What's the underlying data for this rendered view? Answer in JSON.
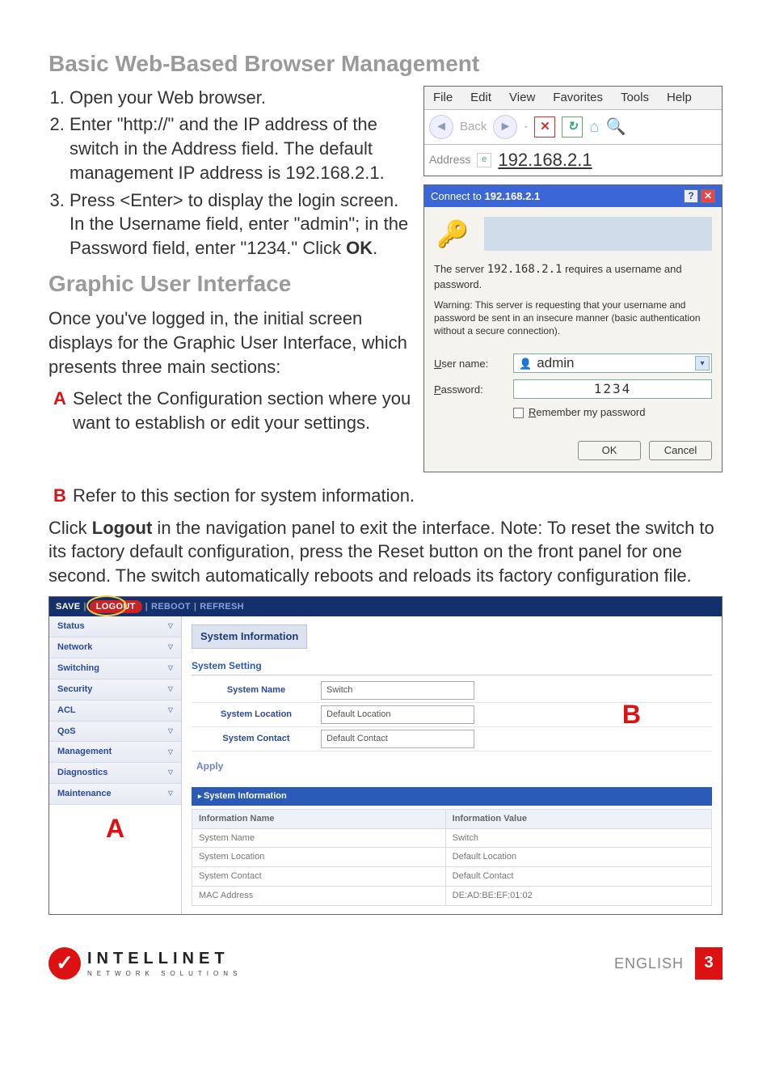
{
  "headings": {
    "h1": "Basic Web-Based Browser Management",
    "h2": "Graphic User Interface"
  },
  "steps": {
    "s1": "Open your Web browser.",
    "s2a": "Enter \"http://\" and the IP address of the switch in the Address field. The default management IP address is 192.168.2.1.",
    "s3a": "Press <Enter> to display the login screen. In the Username field, enter \"admin\"; in the Password field, enter \"1234.\" Click ",
    "s3b": "OK",
    "s3c": "."
  },
  "gui_intro": "Once you've logged in, the initial screen displays for the Graphic User Interface, which presents three main sections:",
  "letters": {
    "a_label": "A",
    "a_text": "Select the Configuration section where you want to establish or edit your settings.",
    "b_label": "B",
    "b_text": "Refer to this section for system information."
  },
  "logout_para_a": "Click ",
  "logout_para_b": "Logout",
  "logout_para_c": " in the navigation panel to exit the interface. Note: To reset the switch to its factory default configuration, press the Reset button on the front panel for one second. The switch automatically reboots and reloads its factory configuration file.",
  "browser": {
    "menu": {
      "file": "File",
      "edit": "Edit",
      "view": "View",
      "fav": "Favorites",
      "tools": "Tools",
      "help": "Help"
    },
    "back": "Back",
    "addr_label": "Address",
    "addr_value": "192.168.2.1"
  },
  "login": {
    "title_a": "Connect to ",
    "title_b": "192.168.2.1",
    "msg_a": "The server ",
    "msg_ip": "192.168.2.1",
    "msg_b": " requires a username and password.",
    "warn": "Warning: This server is requesting that your username and password be sent in an insecure manner (basic authentication without a secure connection).",
    "user_label": "User name:",
    "user_letter": "U",
    "user_rest": "ser name:",
    "user_value": "admin",
    "pw_label": "Password:",
    "pw_letter": "P",
    "pw_rest": "assword:",
    "pw_value": "1234",
    "remember": "Remember my password",
    "remember_letter": "R",
    "remember_rest": "emember my password",
    "ok": "OK",
    "cancel": "Cancel"
  },
  "gui": {
    "top": {
      "save": "SAVE",
      "logout": "LOGOUT",
      "reboot": "REBOOT",
      "refresh": "REFRESH"
    },
    "side": [
      "Status",
      "Network",
      "Switching",
      "Security",
      "ACL",
      "QoS",
      "Management",
      "Diagnostics",
      "Maintenance"
    ],
    "letterA": "A",
    "letterB": "B",
    "title": "System Information",
    "sub": "System Setting",
    "rows": [
      {
        "label": "System Name",
        "value": "Switch"
      },
      {
        "label": "System Location",
        "value": "Default Location"
      },
      {
        "label": "System Contact",
        "value": "Default Contact"
      }
    ],
    "apply": "Apply",
    "bar": "System Information",
    "info_head": {
      "name": "Information Name",
      "value": "Information Value"
    },
    "info": [
      {
        "name": "System Name",
        "value": "Switch"
      },
      {
        "name": "System Location",
        "value": "Default Location"
      },
      {
        "name": "System Contact",
        "value": "Default Contact"
      },
      {
        "name": "MAC Address",
        "value": "DE:AD:BE:EF:01:02"
      }
    ]
  },
  "footer": {
    "brand": "INTELLINET",
    "sub": "NETWORK SOLUTIONS",
    "lang": "ENGLISH",
    "page": "3"
  }
}
